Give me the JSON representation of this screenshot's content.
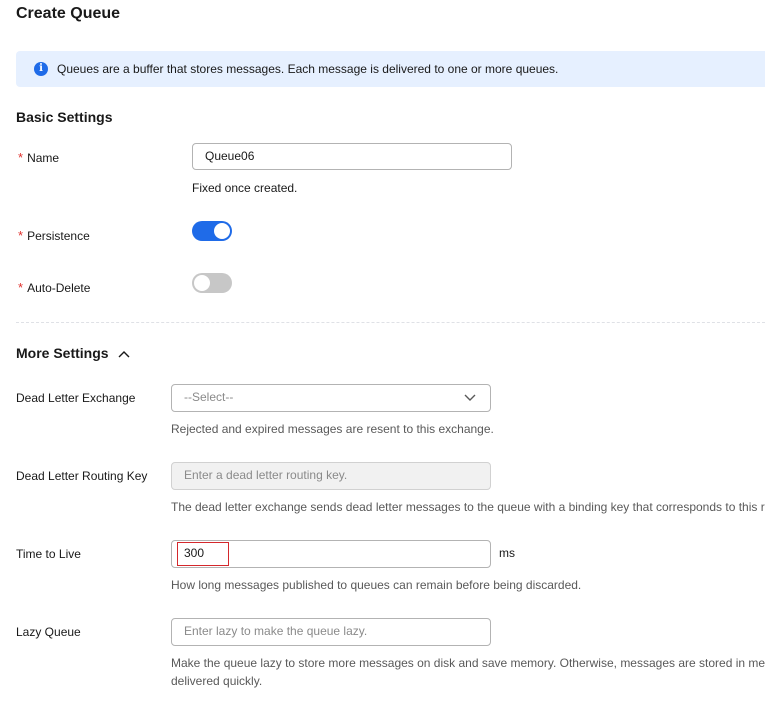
{
  "page": {
    "title": "Create Queue"
  },
  "banner": {
    "icon": "info-icon",
    "text": "Queues are a buffer that stores messages. Each message is delivered to one or more queues."
  },
  "basic": {
    "heading": "Basic Settings",
    "name": {
      "label": "Name",
      "value": "Queue06",
      "hint": "Fixed once created."
    },
    "persistence": {
      "label": "Persistence",
      "enabled": true
    },
    "auto_delete": {
      "label": "Auto-Delete",
      "enabled": false
    }
  },
  "more": {
    "heading": "More Settings",
    "expanded": true,
    "dead_letter_exchange": {
      "label": "Dead Letter Exchange",
      "selected": "--Select--",
      "hint": "Rejected and expired messages are resent to this exchange."
    },
    "dead_letter_routing_key": {
      "label": "Dead Letter Routing Key",
      "placeholder": "Enter a dead letter routing key.",
      "hint": "The dead letter exchange sends dead letter messages to the queue with a binding key that corresponds to this r"
    },
    "time_to_live": {
      "label": "Time to Live",
      "value": "300",
      "unit": "ms",
      "hint": "How long messages published to queues can remain before being discarded."
    },
    "lazy_queue": {
      "label": "Lazy Queue",
      "placeholder": "Enter lazy to make the queue lazy.",
      "hint_line1": "Make the queue lazy to store more messages on disk and save memory. Otherwise, messages are stored in me",
      "hint_line2": "delivered quickly."
    }
  },
  "colors": {
    "accent": "#1f6be8",
    "required": "#e0302d",
    "banner_bg": "#e6f0ff",
    "highlight": "#d4282c"
  }
}
